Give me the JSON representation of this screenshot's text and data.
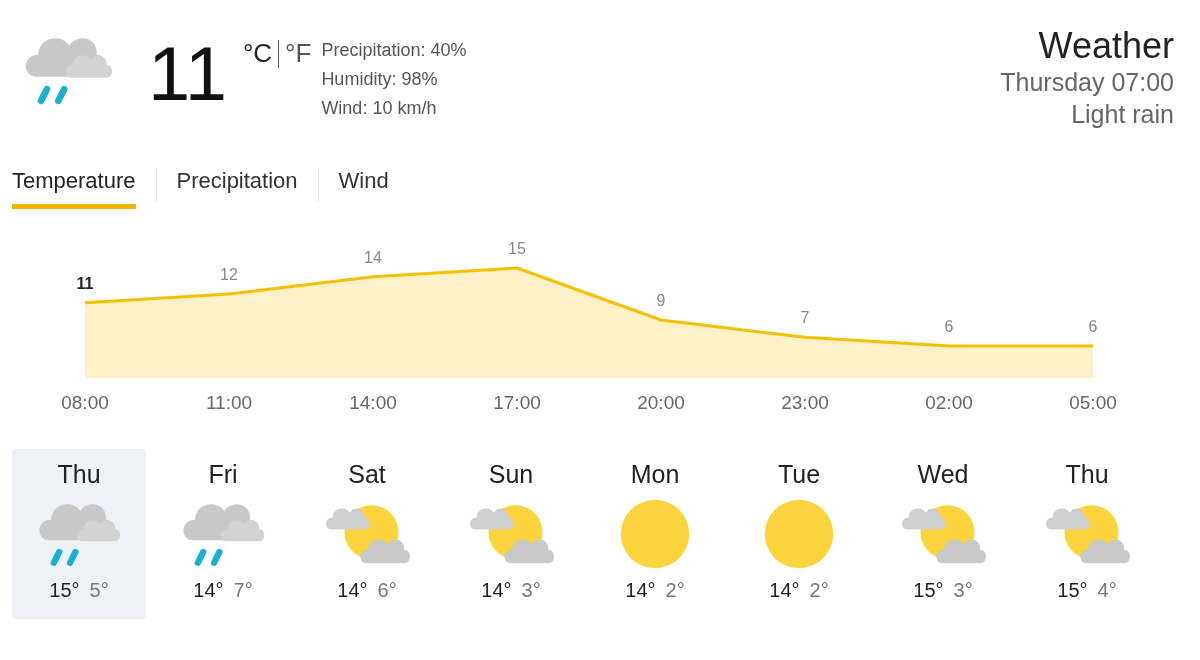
{
  "current": {
    "kind": "rain",
    "temperature": "11",
    "units": [
      {
        "label": "°C",
        "selected": true
      },
      {
        "label": "°F",
        "selected": false
      }
    ],
    "details": [
      "Precipitation: 40%",
      "Humidity: 98%",
      "Wind: 10 km/h"
    ]
  },
  "header": {
    "title": "Weather",
    "time": "Thursday 07:00",
    "condition": "Light rain"
  },
  "tabs": [
    {
      "label": "Temperature",
      "selected": true
    },
    {
      "label": "Precipitation",
      "selected": false
    },
    {
      "label": "Wind",
      "selected": false
    }
  ],
  "chart_data": {
    "type": "area",
    "categories": [
      "08:00",
      "11:00",
      "14:00",
      "17:00",
      "20:00",
      "23:00",
      "02:00",
      "05:00"
    ],
    "data_labels": true,
    "series": [
      {
        "color": "#f4c000",
        "values": [
          11,
          12,
          14,
          15,
          9,
          7,
          6,
          6
        ]
      }
    ]
  },
  "days": [
    {
      "day": "Thu",
      "kind": "rain",
      "high": "15°",
      "low": "5°",
      "selected": true
    },
    {
      "day": "Fri",
      "kind": "rain",
      "high": "14°",
      "low": "7°",
      "selected": false
    },
    {
      "day": "Sat",
      "kind": "partly_sunny",
      "high": "14°",
      "low": "6°",
      "selected": false
    },
    {
      "day": "Sun",
      "kind": "partly_sunny",
      "high": "14°",
      "low": "3°",
      "selected": false
    },
    {
      "day": "Mon",
      "kind": "sunny",
      "high": "14°",
      "low": "2°",
      "selected": false
    },
    {
      "day": "Tue",
      "kind": "sunny",
      "high": "14°",
      "low": "2°",
      "selected": false
    },
    {
      "day": "Wed",
      "kind": "partly_sunny",
      "high": "15°",
      "low": "3°",
      "selected": false
    },
    {
      "day": "Thu",
      "kind": "partly_sunny",
      "high": "15°",
      "low": "4°",
      "selected": false
    }
  ]
}
